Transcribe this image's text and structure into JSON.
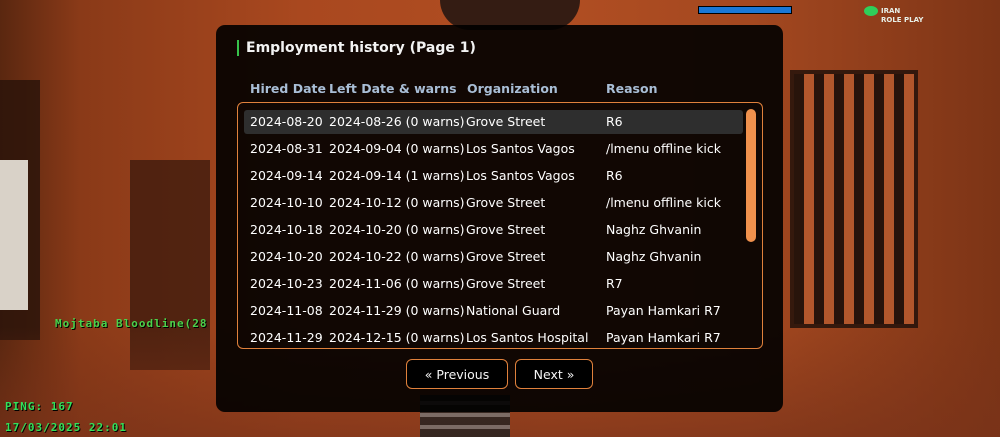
{
  "dialog": {
    "title": "Employment history (Page 1)",
    "columns": [
      "Hired Date",
      "Left Date & warns",
      "Organization",
      "Reason"
    ],
    "rows": [
      {
        "hired": "2024-08-20",
        "left": "2024-08-26 (0 warns)",
        "org": "Grove Street",
        "reason": "R6"
      },
      {
        "hired": "2024-08-31",
        "left": "2024-09-04 (0 warns)",
        "org": "Los Santos Vagos",
        "reason": "/lmenu offline kick"
      },
      {
        "hired": "2024-09-14",
        "left": "2024-09-14 (1 warns)",
        "org": "Los Santos Vagos",
        "reason": "R6"
      },
      {
        "hired": "2024-10-10",
        "left": "2024-10-12 (0 warns)",
        "org": "Grove Street",
        "reason": "/lmenu offline kick"
      },
      {
        "hired": "2024-10-18",
        "left": "2024-10-20 (0 warns)",
        "org": "Grove Street",
        "reason": "Naghz Ghvanin"
      },
      {
        "hired": "2024-10-20",
        "left": "2024-10-22 (0 warns)",
        "org": "Grove Street",
        "reason": "Naghz Ghvanin"
      },
      {
        "hired": "2024-10-23",
        "left": "2024-11-06 (0 warns)",
        "org": "Grove Street",
        "reason": "R7"
      },
      {
        "hired": "2024-11-08",
        "left": "2024-11-29 (0 warns)",
        "org": "National Guard",
        "reason": "Payan Hamkari R7"
      },
      {
        "hired": "2024-11-29",
        "left": "2024-12-15 (0 warns)",
        "org": "Los Santos Hospital",
        "reason": "Payan Hamkari R7"
      }
    ],
    "selected_row": 0,
    "buttons": {
      "previous": "« Previous",
      "next": "Next »"
    }
  },
  "hud": {
    "player_name": "Mojtaba Bloodline(28",
    "ping": "PING: 167",
    "datetime": "17/03/2025 22:01",
    "logo_line1": "IRAN",
    "logo_line2": "ROLE PLAY"
  },
  "colors": {
    "accent": "#e0813c",
    "scrollbar": "#f0914d",
    "header_text": "#a9bed6",
    "hud_green": "#33e05a"
  }
}
